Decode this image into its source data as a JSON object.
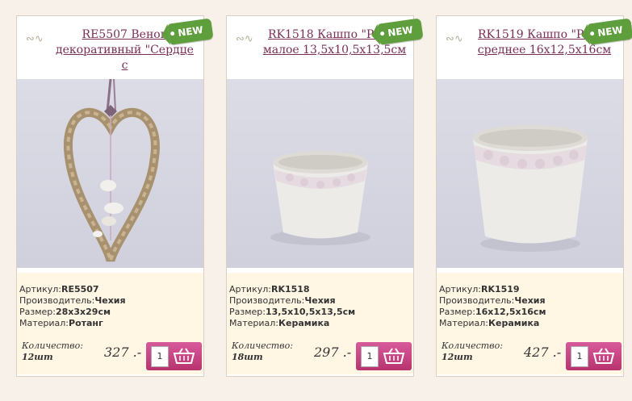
{
  "products": [
    {
      "title": "RE5507 Венок декоративный \"Сердце с",
      "badge": "NEW",
      "sku_label": "Артикул:",
      "sku": "RE5507",
      "maker_label": "Производитель:",
      "maker": "Чехия",
      "size_label": "Размер:",
      "size": "28х3х29см",
      "material_label": "Материал:",
      "material": "Ротанг",
      "qty_label": "Количество:",
      "stock": "12шт",
      "price": "327 .-",
      "qty": "1"
    },
    {
      "title": "RK1518 Кашпо \"Розы\" малое 13,5х10,5х13,5см",
      "badge": "NEW",
      "sku_label": "Артикул:",
      "sku": "RK1518",
      "maker_label": "Производитель:",
      "maker": "Чехия",
      "size_label": "Размер:",
      "size": "13,5х10,5х13,5см",
      "material_label": "Материал:",
      "material": "Керамика",
      "qty_label": "Количество:",
      "stock": "18шт",
      "price": "297 .-",
      "qty": "1"
    },
    {
      "title": "RK1519 Кашпо \"Розы\" среднее 16х12,5х16см",
      "badge": "NEW",
      "sku_label": "Артикул:",
      "sku": "RK1519",
      "maker_label": "Производитель:",
      "maker": "Чехия",
      "size_label": "Размер:",
      "size": "16х12,5х16см",
      "material_label": "Материал:",
      "material": "Керамика",
      "qty_label": "Количество:",
      "stock": "12шт",
      "price": "427 .-",
      "qty": "1"
    }
  ],
  "colors": {
    "title": "#7a2f57",
    "badge": "#5f9e3d",
    "buy_button": "#c8457f",
    "info_bg": "#fff6e4"
  }
}
